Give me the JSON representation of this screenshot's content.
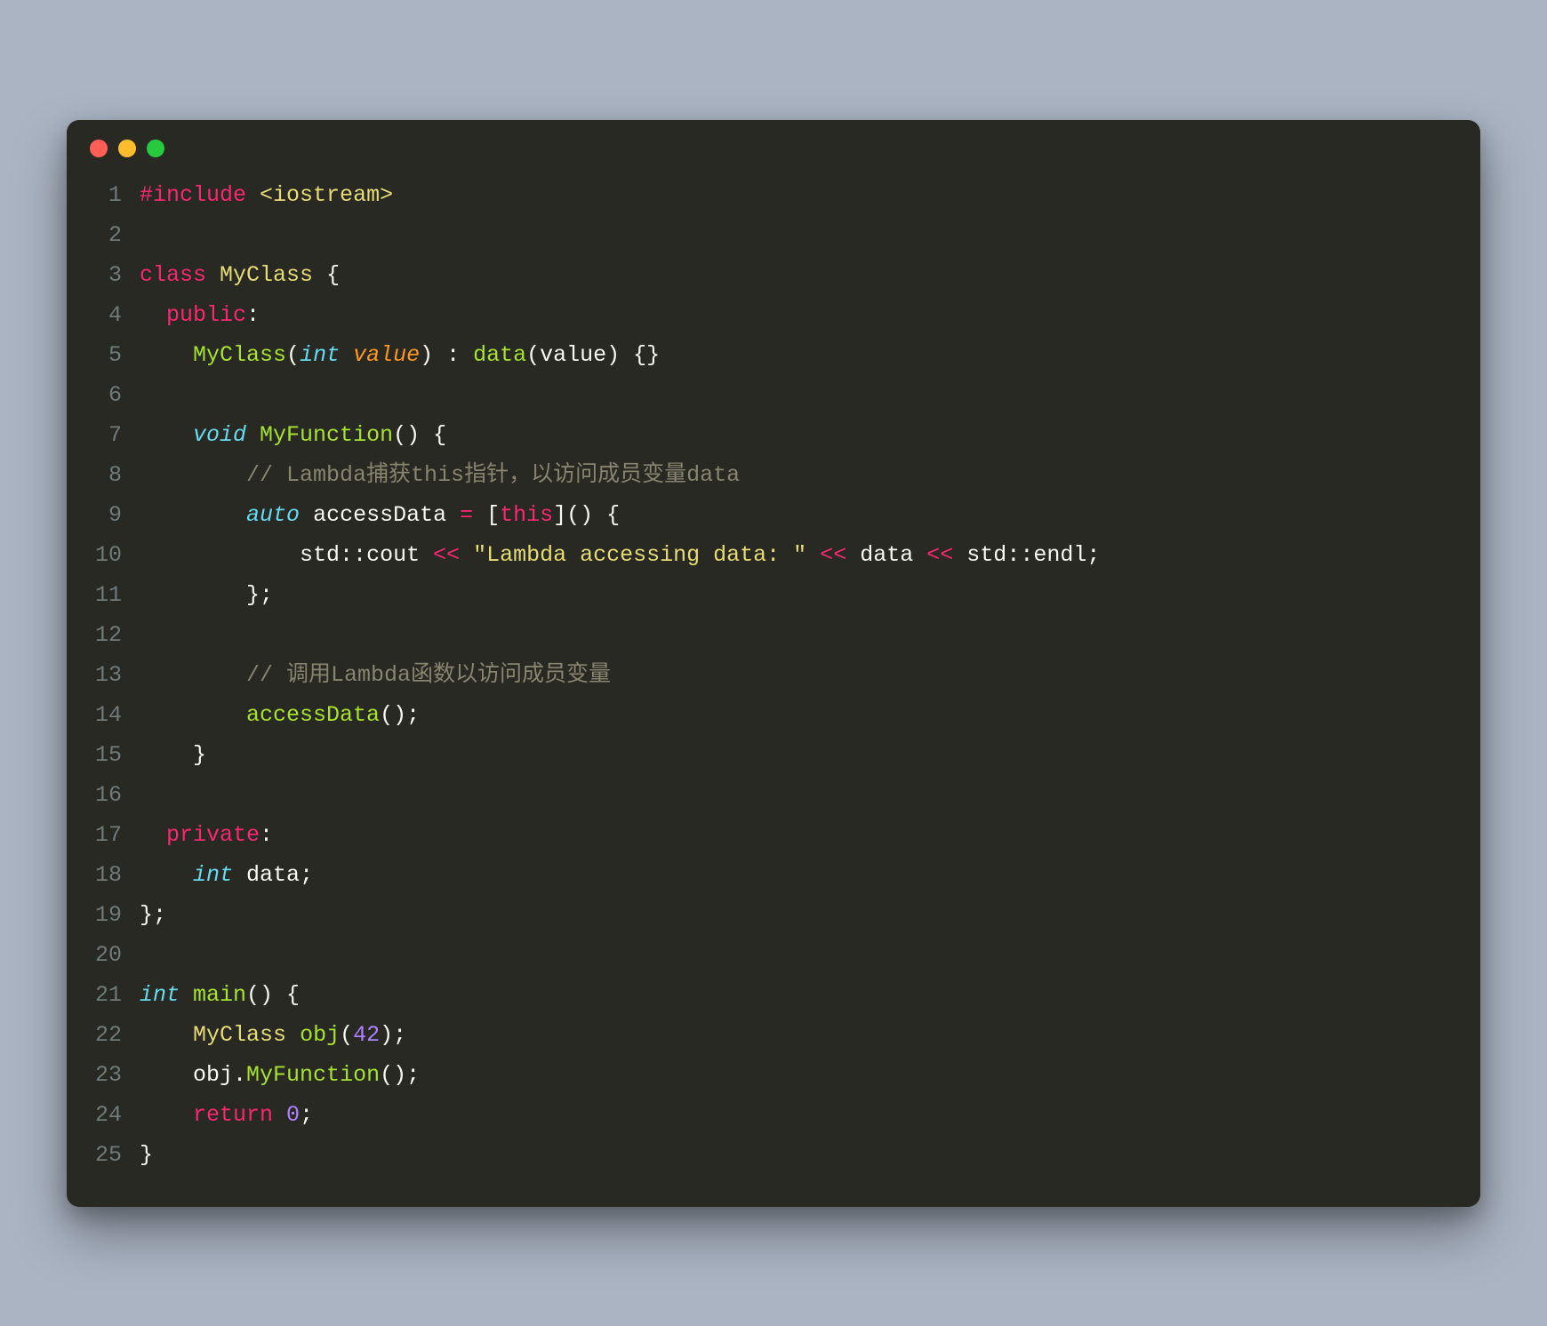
{
  "window": {
    "dots": [
      "red",
      "yellow",
      "green"
    ]
  },
  "code": {
    "lines": [
      {
        "n": "1",
        "tokens": [
          {
            "c": "c-keyword",
            "t": "#include"
          },
          {
            "c": "c-punct",
            "t": " "
          },
          {
            "c": "c-string",
            "t": "<iostream>"
          }
        ]
      },
      {
        "n": "2",
        "tokens": []
      },
      {
        "n": "3",
        "tokens": [
          {
            "c": "c-keyword",
            "t": "class"
          },
          {
            "c": "c-punct",
            "t": " "
          },
          {
            "c": "c-classname",
            "t": "MyClass"
          },
          {
            "c": "c-punct",
            "t": " {"
          }
        ]
      },
      {
        "n": "4",
        "tokens": [
          {
            "c": "c-punct",
            "t": "  "
          },
          {
            "c": "c-keyword",
            "t": "public"
          },
          {
            "c": "c-punct",
            "t": ":"
          }
        ]
      },
      {
        "n": "5",
        "tokens": [
          {
            "c": "c-punct",
            "t": "    "
          },
          {
            "c": "c-func",
            "t": "MyClass"
          },
          {
            "c": "c-punct",
            "t": "("
          },
          {
            "c": "c-type",
            "t": "int"
          },
          {
            "c": "c-punct",
            "t": " "
          },
          {
            "c": "c-param",
            "t": "value"
          },
          {
            "c": "c-punct",
            "t": ") : "
          },
          {
            "c": "c-func",
            "t": "data"
          },
          {
            "c": "c-punct",
            "t": "("
          },
          {
            "c": "c-ident",
            "t": "value"
          },
          {
            "c": "c-punct",
            "t": ") {}"
          }
        ]
      },
      {
        "n": "6",
        "tokens": []
      },
      {
        "n": "7",
        "tokens": [
          {
            "c": "c-punct",
            "t": "    "
          },
          {
            "c": "c-type",
            "t": "void"
          },
          {
            "c": "c-punct",
            "t": " "
          },
          {
            "c": "c-func",
            "t": "MyFunction"
          },
          {
            "c": "c-punct",
            "t": "() {"
          }
        ]
      },
      {
        "n": "8",
        "tokens": [
          {
            "c": "c-punct",
            "t": "        "
          },
          {
            "c": "c-comment",
            "t": "// Lambda捕获this指针，以访问成员变量data"
          }
        ]
      },
      {
        "n": "9",
        "tokens": [
          {
            "c": "c-punct",
            "t": "        "
          },
          {
            "c": "c-type",
            "t": "auto"
          },
          {
            "c": "c-punct",
            "t": " "
          },
          {
            "c": "c-ident",
            "t": "accessData"
          },
          {
            "c": "c-punct",
            "t": " "
          },
          {
            "c": "c-keyword",
            "t": "="
          },
          {
            "c": "c-punct",
            "t": " ["
          },
          {
            "c": "c-keyword",
            "t": "this"
          },
          {
            "c": "c-punct",
            "t": "]() {"
          }
        ]
      },
      {
        "n": "10",
        "tokens": [
          {
            "c": "c-punct",
            "t": "            "
          },
          {
            "c": "c-namespace",
            "t": "std"
          },
          {
            "c": "c-punct",
            "t": "::"
          },
          {
            "c": "c-ident",
            "t": "cout"
          },
          {
            "c": "c-punct",
            "t": " "
          },
          {
            "c": "c-keyword",
            "t": "<<"
          },
          {
            "c": "c-punct",
            "t": " "
          },
          {
            "c": "c-string",
            "t": "\"Lambda accessing data: \""
          },
          {
            "c": "c-punct",
            "t": " "
          },
          {
            "c": "c-keyword",
            "t": "<<"
          },
          {
            "c": "c-punct",
            "t": " "
          },
          {
            "c": "c-ident",
            "t": "data"
          },
          {
            "c": "c-punct",
            "t": " "
          },
          {
            "c": "c-keyword",
            "t": "<<"
          },
          {
            "c": "c-punct",
            "t": " "
          },
          {
            "c": "c-namespace",
            "t": "std"
          },
          {
            "c": "c-punct",
            "t": "::"
          },
          {
            "c": "c-ident",
            "t": "endl"
          },
          {
            "c": "c-punct",
            "t": ";"
          }
        ]
      },
      {
        "n": "11",
        "tokens": [
          {
            "c": "c-punct",
            "t": "        };"
          }
        ]
      },
      {
        "n": "12",
        "tokens": []
      },
      {
        "n": "13",
        "tokens": [
          {
            "c": "c-punct",
            "t": "        "
          },
          {
            "c": "c-comment",
            "t": "// 调用Lambda函数以访问成员变量"
          }
        ]
      },
      {
        "n": "14",
        "tokens": [
          {
            "c": "c-punct",
            "t": "        "
          },
          {
            "c": "c-func",
            "t": "accessData"
          },
          {
            "c": "c-punct",
            "t": "();"
          }
        ]
      },
      {
        "n": "15",
        "tokens": [
          {
            "c": "c-punct",
            "t": "    }"
          }
        ]
      },
      {
        "n": "16",
        "tokens": []
      },
      {
        "n": "17",
        "tokens": [
          {
            "c": "c-punct",
            "t": "  "
          },
          {
            "c": "c-keyword",
            "t": "private"
          },
          {
            "c": "c-punct",
            "t": ":"
          }
        ]
      },
      {
        "n": "18",
        "tokens": [
          {
            "c": "c-punct",
            "t": "    "
          },
          {
            "c": "c-type",
            "t": "int"
          },
          {
            "c": "c-punct",
            "t": " "
          },
          {
            "c": "c-ident",
            "t": "data"
          },
          {
            "c": "c-punct",
            "t": ";"
          }
        ]
      },
      {
        "n": "19",
        "tokens": [
          {
            "c": "c-punct",
            "t": "};"
          }
        ]
      },
      {
        "n": "20",
        "tokens": []
      },
      {
        "n": "21",
        "tokens": [
          {
            "c": "c-type",
            "t": "int"
          },
          {
            "c": "c-punct",
            "t": " "
          },
          {
            "c": "c-func",
            "t": "main"
          },
          {
            "c": "c-punct",
            "t": "() {"
          }
        ]
      },
      {
        "n": "22",
        "tokens": [
          {
            "c": "c-punct",
            "t": "    "
          },
          {
            "c": "c-classname",
            "t": "MyClass"
          },
          {
            "c": "c-punct",
            "t": " "
          },
          {
            "c": "c-func",
            "t": "obj"
          },
          {
            "c": "c-punct",
            "t": "("
          },
          {
            "c": "c-number",
            "t": "42"
          },
          {
            "c": "c-punct",
            "t": ");"
          }
        ]
      },
      {
        "n": "23",
        "tokens": [
          {
            "c": "c-punct",
            "t": "    "
          },
          {
            "c": "c-ident",
            "t": "obj"
          },
          {
            "c": "c-punct",
            "t": "."
          },
          {
            "c": "c-func",
            "t": "MyFunction"
          },
          {
            "c": "c-punct",
            "t": "();"
          }
        ]
      },
      {
        "n": "24",
        "tokens": [
          {
            "c": "c-punct",
            "t": "    "
          },
          {
            "c": "c-keyword",
            "t": "return"
          },
          {
            "c": "c-punct",
            "t": " "
          },
          {
            "c": "c-number",
            "t": "0"
          },
          {
            "c": "c-punct",
            "t": ";"
          }
        ]
      },
      {
        "n": "25",
        "tokens": [
          {
            "c": "c-punct",
            "t": "}"
          }
        ]
      }
    ]
  }
}
